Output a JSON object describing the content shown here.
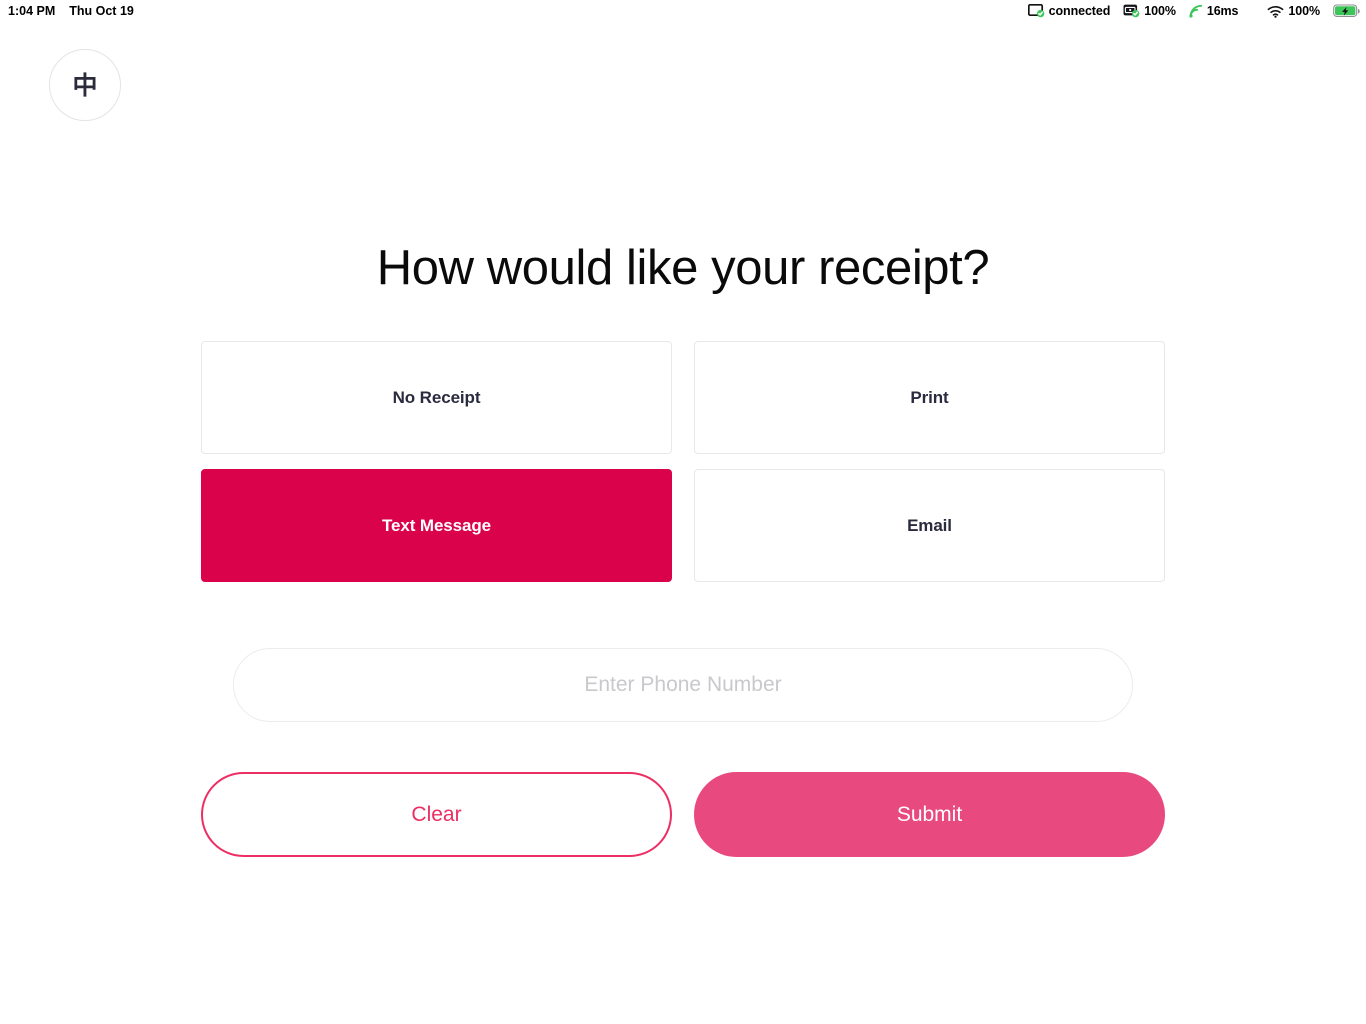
{
  "status_bar": {
    "time": "1:04 PM",
    "date": "Thu Oct 19",
    "display": {
      "icon": "display-monitor-icon",
      "label": "connected"
    },
    "card_reader": {
      "icon": "card-reader-icon",
      "label": "100%"
    },
    "network": {
      "icon": "signal-bars-icon",
      "label": "16ms"
    },
    "wifi": {
      "icon": "wifi-icon",
      "label": "100%"
    },
    "battery": {
      "icon": "battery-charging-icon"
    }
  },
  "language_button": {
    "icon": "language-toggle-icon",
    "label": "中"
  },
  "main": {
    "title": "How would like your receipt?",
    "options": [
      {
        "id": "no-receipt",
        "label": "No Receipt",
        "selected": false
      },
      {
        "id": "print",
        "label": "Print",
        "selected": false
      },
      {
        "id": "text-message",
        "label": "Text Message",
        "selected": true
      },
      {
        "id": "email",
        "label": "Email",
        "selected": false
      }
    ],
    "phone_input": {
      "placeholder": "Enter Phone Number",
      "value": ""
    },
    "actions": {
      "clear_label": "Clear",
      "submit_label": "Submit"
    }
  },
  "colors": {
    "selected_option": "#d9024b",
    "submit": "#e8497e",
    "clear_outline": "#ec2e63",
    "text_dark": "#2b2b3f",
    "border": "#e8e8ea",
    "status_green": "#3ec65a"
  }
}
